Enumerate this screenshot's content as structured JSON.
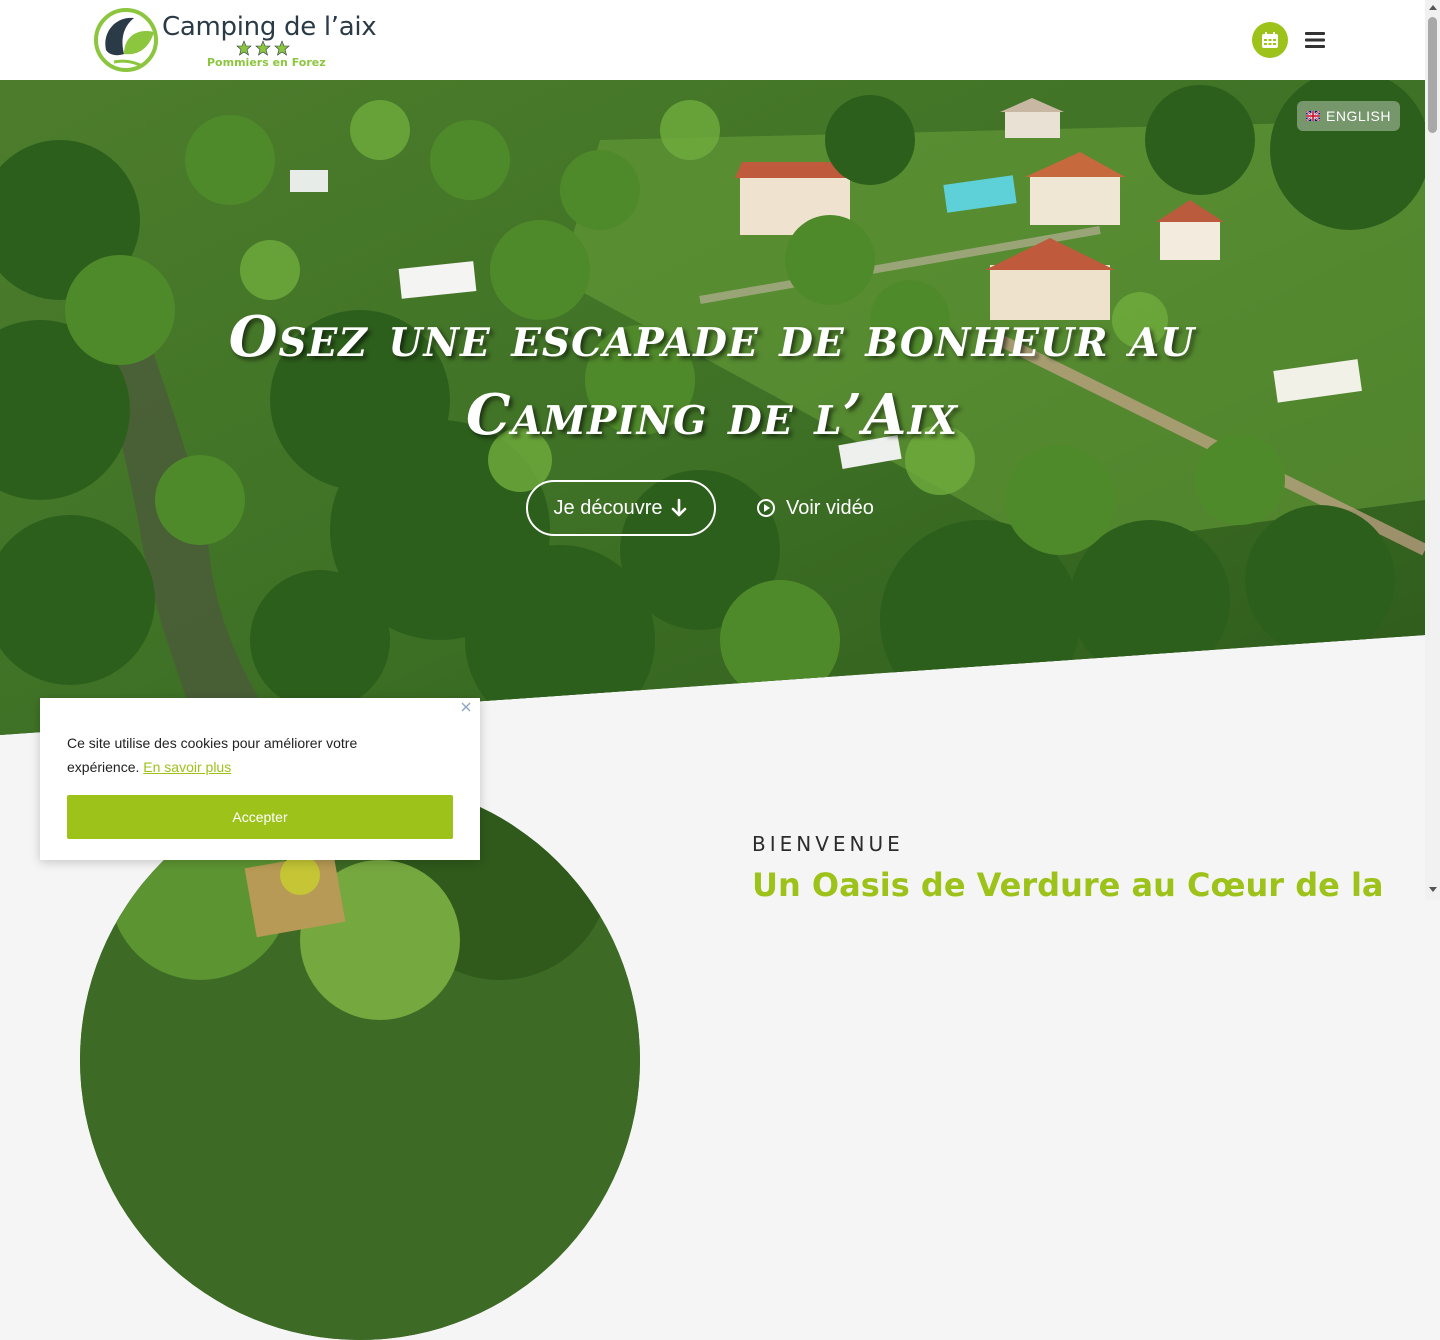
{
  "colors": {
    "accent_green": "#9dc21a",
    "logo_green": "#8cc63f",
    "logo_navy": "#2a3b47",
    "white": "#ffffff"
  },
  "header": {
    "logo_title": "Camping de l’aix",
    "logo_subtitle": "Pommiers en Forez",
    "logo_stars": 3,
    "calendar_icon": "calendar-icon",
    "menu_icon": "hamburger-menu-icon"
  },
  "hero": {
    "language_label": "ENGLISH",
    "flag_icon": "uk-flag-icon",
    "title_line1": "Osez une escapade de bonheur au",
    "title_line2": "Camping de l’Aix",
    "discover_label": "Je découvre",
    "discover_icon": "arrow-down-icon",
    "video_label": "Voir vidéo",
    "video_icon": "play-circle-icon"
  },
  "welcome": {
    "kicker": "BIENVENUE",
    "title": "Un Oasis de Verdure au Cœur de la"
  },
  "cookie": {
    "text": "Ce site utilise des cookies pour améliorer votre expérience.",
    "link_label": "En savoir plus",
    "accept_label": "Accepter",
    "close_icon": "close-icon"
  }
}
